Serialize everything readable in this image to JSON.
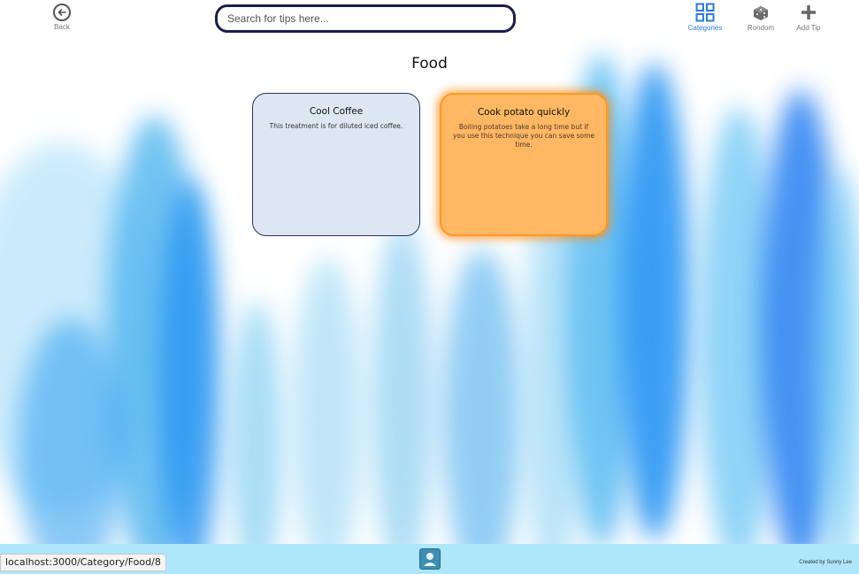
{
  "header": {
    "back_label": "Back",
    "search_placeholder": "Search for tips here...",
    "nav": [
      {
        "label": "Categories",
        "icon": "grid-icon",
        "active": true
      },
      {
        "label": "Rondom",
        "icon": "dice-icon",
        "active": false
      },
      {
        "label": "Add Tip",
        "icon": "plus-icon",
        "active": false
      }
    ]
  },
  "main": {
    "title": "Food",
    "cards": [
      {
        "title": "Cool Coffee",
        "text": "This treatment is for diluted iced coffee."
      },
      {
        "title": "Cook potato quickly",
        "text": "Boiling potatoes take a long time but if you use this technique you can save some time."
      }
    ]
  },
  "footer": {
    "status_url": "localhost:3000/Category/Food/8",
    "credit": "Created by Sunny Lee"
  },
  "colors": {
    "accent": "#2a7ae2",
    "search_border": "#1a1d4e",
    "card_default": "#dce7f1",
    "card_highlight": "#ffb763",
    "footer": "#aee6fb"
  }
}
